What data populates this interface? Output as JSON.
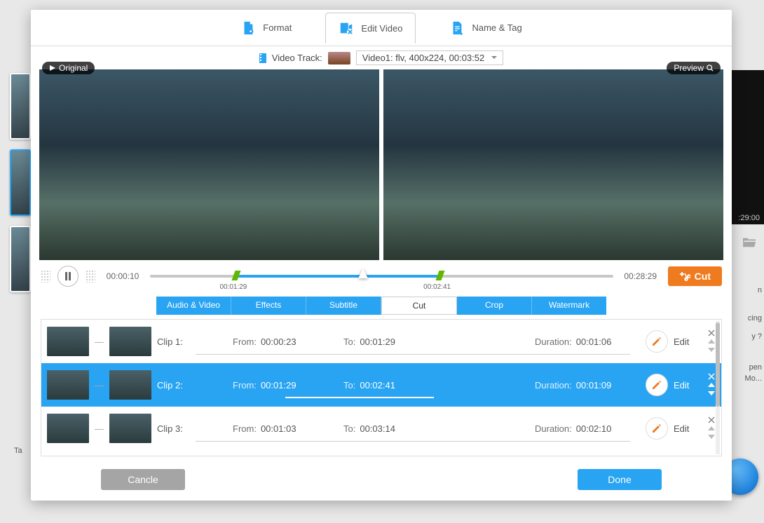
{
  "top_tabs": {
    "format": "Format",
    "edit_video": "Edit Video",
    "name_tag": "Name & Tag"
  },
  "track": {
    "label": "Video Track:",
    "selected": "Video1: flv, 400x224, 00:03:52"
  },
  "badges": {
    "original": "Original",
    "preview": "Preview"
  },
  "transport": {
    "current": "00:00:10",
    "total": "00:28:29",
    "marker_start": "00:01:29",
    "marker_end": "00:02:41",
    "cut_label": "Cut"
  },
  "sub_tabs": {
    "av": "Audio & Video",
    "effects": "Effects",
    "subtitle": "Subtitle",
    "cut": "Cut",
    "crop": "Crop",
    "watermark": "Watermark"
  },
  "labels": {
    "from": "From:",
    "to": "To:",
    "duration": "Duration:",
    "edit": "Edit"
  },
  "clips": [
    {
      "name": "Clip 1:",
      "from": "00:00:23",
      "to": "00:01:29",
      "duration": "00:01:06",
      "selected": false
    },
    {
      "name": "Clip 2:",
      "from": "00:01:29",
      "to": "00:02:41",
      "duration": "00:01:09",
      "selected": true
    },
    {
      "name": "Clip 3:",
      "from": "00:01:03",
      "to": "00:03:14",
      "duration": "00:02:10",
      "selected": false
    }
  ],
  "footer": {
    "cancel": "Cancle",
    "done": "Done"
  },
  "background": {
    "time": ":29:00",
    "t1": "cing",
    "t2": "y ?",
    "t3": "pen",
    "t4": "Mo...",
    "t5": "n",
    "ta": "Ta"
  }
}
